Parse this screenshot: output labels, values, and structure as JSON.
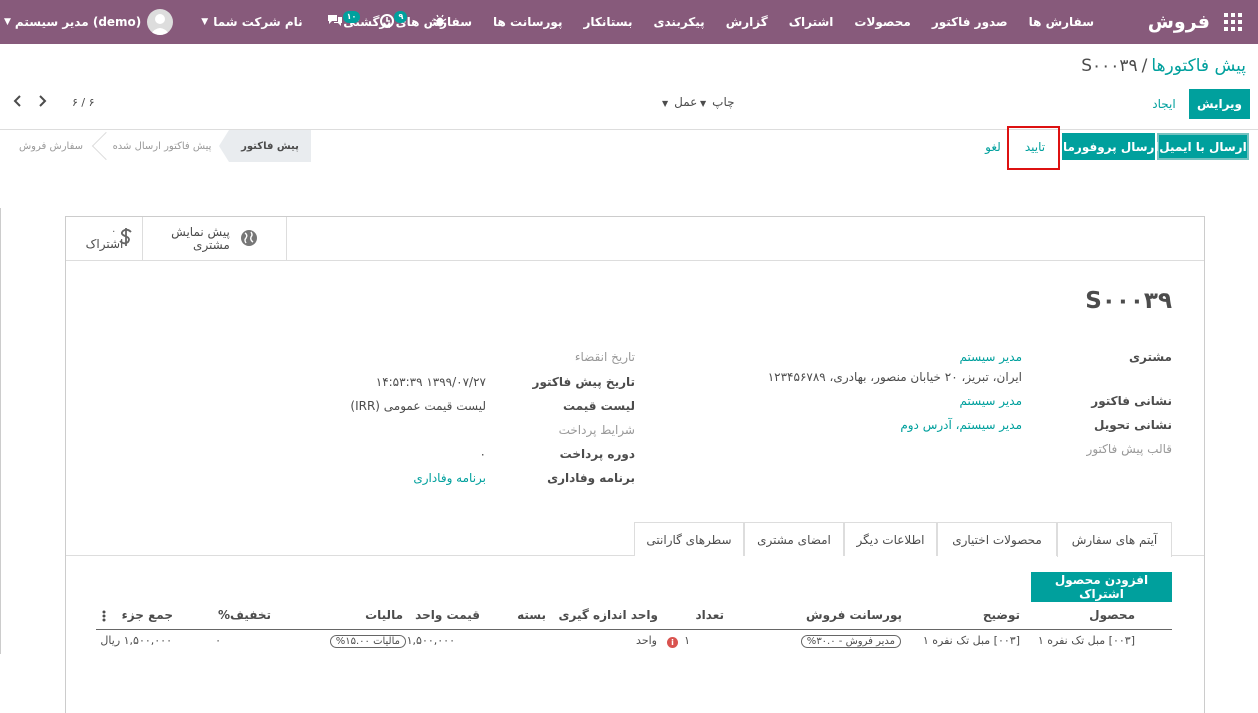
{
  "navbar": {
    "brand": "فروش",
    "menu": [
      "سفارش ها",
      "صدور فاکتور",
      "محصولات",
      "اشتراک",
      "گزارش",
      "پیکربندی",
      "بستانکار",
      "پورسانت ها",
      "سفارش های برگشتی"
    ],
    "company": "نام شرکت شما",
    "user": "مدیر سیستم (demo)",
    "activity_badge": "۹",
    "messages_badge": "۱۰"
  },
  "breadcrumb": {
    "parent": "پیش فاکتورها",
    "separator": "/",
    "current": "S۰۰۰۳۹"
  },
  "actions": {
    "edit": "ویرایش",
    "create": "ایجاد",
    "print": "چاپ",
    "action": "عمل",
    "pager": "۶ / ۶"
  },
  "header_buttons": {
    "send_email": "ارسال با ایمیل",
    "send_proforma": "ارسال پروفورما",
    "confirm": "تایید",
    "cancel": "لغو"
  },
  "stages": {
    "quotation": "پیش فاکتور",
    "sent": "پیش فاکتور ارسال شده",
    "sale_order": "سفارش فروش"
  },
  "smart_buttons": {
    "preview_line1": "پیش نمایش",
    "preview_line2": "مشتری",
    "subscription": "اشتراک",
    "subscription_count": "۰"
  },
  "form": {
    "name": "S۰۰۰۳۹",
    "customer_label": "مشتری",
    "customer_name": "مدیر سیستم",
    "customer_address": "ایران، تبریز، ۲۰ خیابان منصور، بهادری، ۱۲۳۴۵۶۷۸۹",
    "invoice_address_label": "نشانی فاکتور",
    "invoice_address": "مدیر سیستم",
    "delivery_address_label": "نشانی تحویل",
    "delivery_address": "مدیر سیستم، آدرس دوم",
    "template_label": "قالب پیش فاکتور",
    "expiration_label": "تاریخ انقضاء",
    "quotation_date_label": "تاریخ پیش فاکتور",
    "quotation_date": "۱۳۹۹/۰۷/۲۷ ۱۴:۵۳:۳۹",
    "pricelist_label": "لیست قیمت",
    "pricelist": "لیست قیمت عمومی (IRR)",
    "payment_terms_label": "شرایط پرداخت",
    "payment_period_label": "دوره پرداخت",
    "payment_period": "۰",
    "loyalty_label": "برنامه وفاداری",
    "loyalty": "برنامه وفاداری"
  },
  "tabs": [
    "آیتم های سفارش",
    "محصولات اختیاری",
    "اطلاعات دیگر",
    "امضای مشتری",
    "سطرهای گارانتی"
  ],
  "lines": {
    "add_button": "افزودن محصول اشتراک",
    "columns": {
      "product": "محصول",
      "description": "توضیح",
      "commission": "پورسانت فروش",
      "qty": "تعداد",
      "uom": "واحد اندازه گیری",
      "package": "بسته",
      "unit_price": "قیمت واحد",
      "taxes": "مالیات",
      "discount": "تخفیف%",
      "subtotal": "جمع جزء"
    },
    "rows": [
      {
        "product": "[۰۰۳] مبل تک نفره ۱",
        "description": "[۰۰۳] مبل تک نفره ۱",
        "commission": "مدیر فروش - ۳۰.۰%",
        "qty": "۱",
        "uom": "واحد",
        "unit_price": "۱,۵۰۰,۰۰۰",
        "taxes": "مالیات ۱۵.۰۰%",
        "discount": "۰",
        "subtotal": "۱,۵۰۰,۰۰۰ ریال"
      }
    ]
  }
}
